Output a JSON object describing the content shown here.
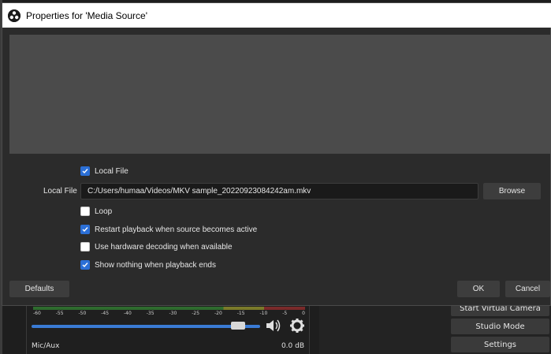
{
  "dialog": {
    "title": "Properties for 'Media Source'",
    "local_file_checkbox": {
      "label": "Local File",
      "checked": true
    },
    "local_file_field": {
      "label": "Local File",
      "value": "C:/Users/humaa/Videos/MKV sample_20220923084242am.mkv"
    },
    "browse_label": "Browse",
    "options": [
      {
        "label": "Loop",
        "checked": false
      },
      {
        "label": "Restart playback when source becomes active",
        "checked": true
      },
      {
        "label": "Use hardware decoding when available",
        "checked": false
      },
      {
        "label": "Show nothing when playback ends",
        "checked": true
      }
    ],
    "defaults_label": "Defaults",
    "ok_label": "OK",
    "cancel_label": "Cancel"
  },
  "background": {
    "mixer": {
      "ticks": [
        "-60",
        "-55",
        "-50",
        "-45",
        "-40",
        "-35",
        "-30",
        "-25",
        "-20",
        "-15",
        "-10",
        "-5",
        "0"
      ],
      "source_name": "Mic/Aux",
      "db_value": "0.0 dB",
      "volume_level": 0.93
    },
    "controls": {
      "start_virtual_camera": "Start Virtual Camera",
      "studio_mode": "Studio Mode",
      "settings": "Settings"
    }
  },
  "colors": {
    "accent": "#2b6fd6",
    "dialog_bg": "#2b2b2b",
    "preview_bg": "#4b4b4b"
  }
}
